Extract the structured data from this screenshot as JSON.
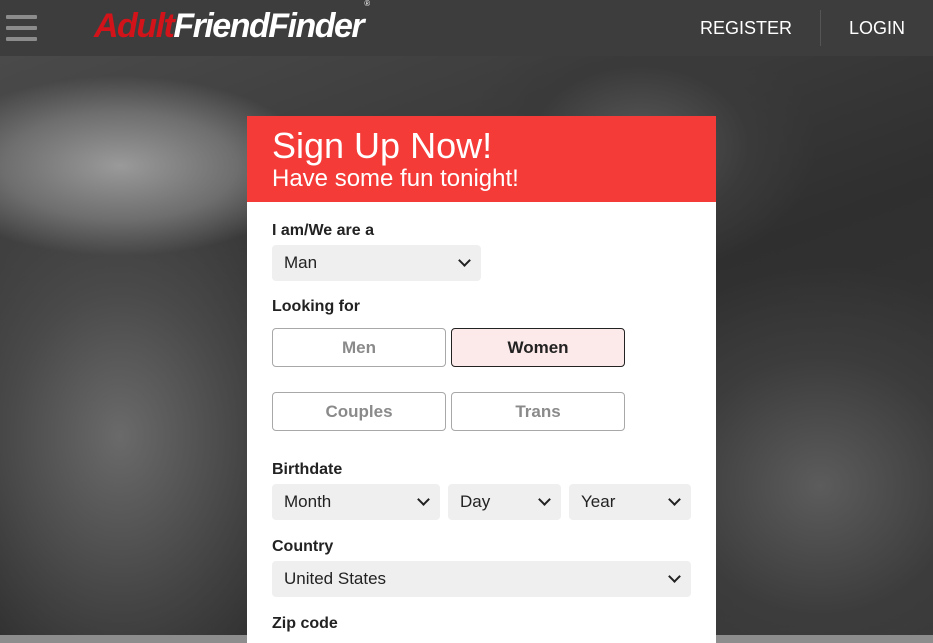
{
  "header": {
    "logo_part1": "Adult",
    "logo_part2": "FriendFinder",
    "logo_reg": "®",
    "register_label": "REGISTER",
    "login_label": "LOGIN"
  },
  "signup": {
    "title": "Sign Up Now!",
    "subtitle": "Have some fun tonight!",
    "iam_label": "I am/We are a",
    "iam_value": "Man",
    "looking_label": "Looking for",
    "options": [
      "Men",
      "Women",
      "Couples",
      "Trans"
    ],
    "selected_option": "Women",
    "birthdate_label": "Birthdate",
    "month_value": "Month",
    "day_value": "Day",
    "year_value": "Year",
    "country_label": "Country",
    "country_value": "United States",
    "zip_label": "Zip code"
  },
  "colors": {
    "accent": "#f43b38",
    "logo_red": "#d2141a",
    "topbar": "#3d3d3d"
  }
}
